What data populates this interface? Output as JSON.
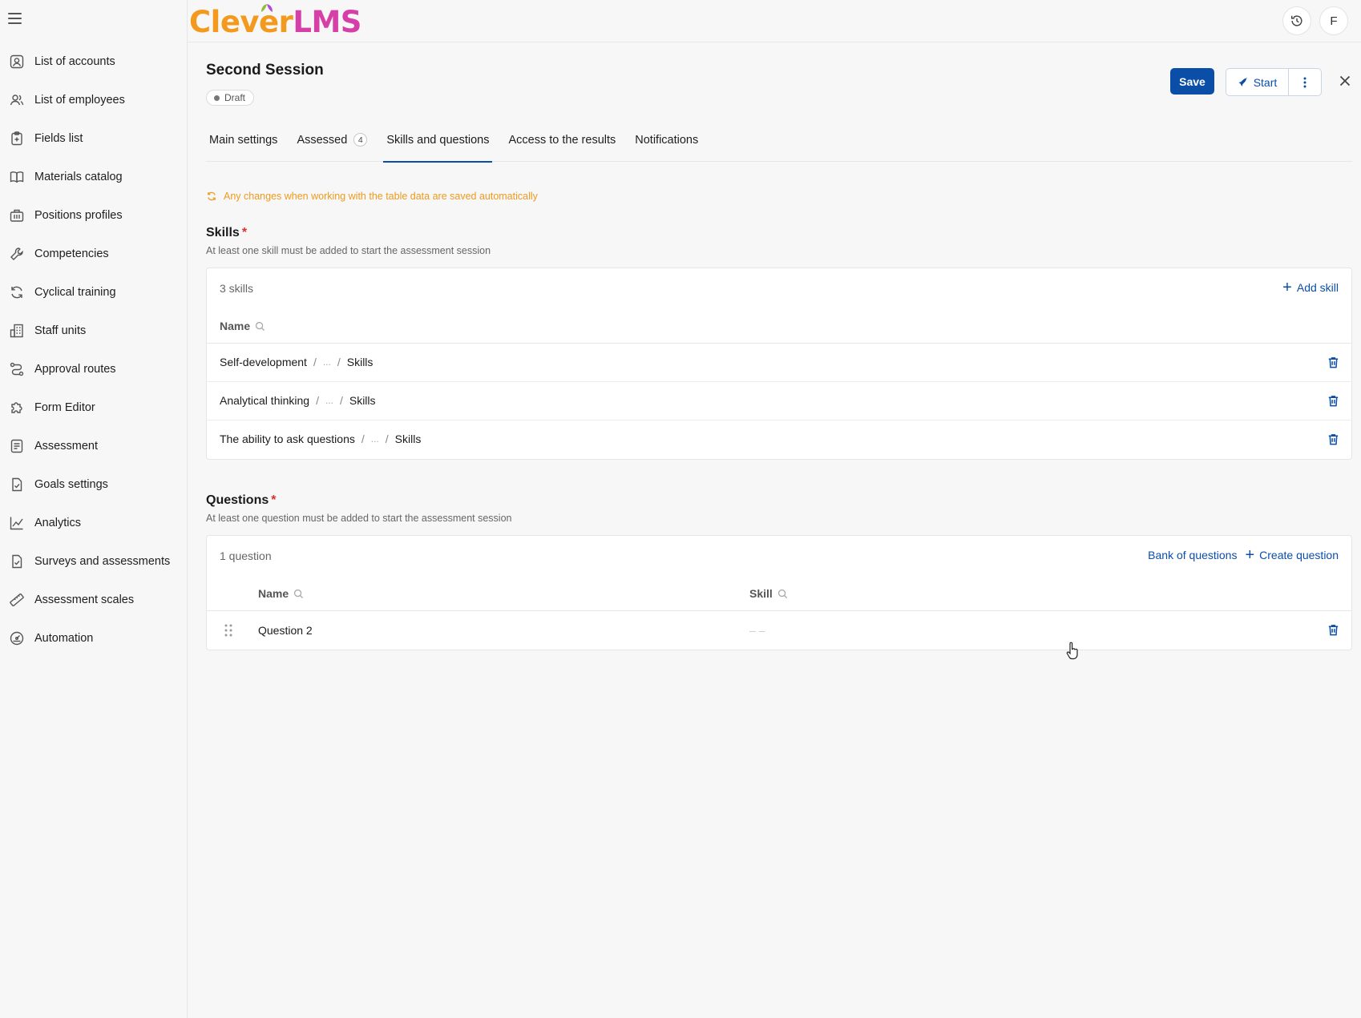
{
  "app": {
    "logo_part1": "Clever",
    "logo_part2": "LMS",
    "user_initial": "F"
  },
  "sidebar": {
    "items": [
      {
        "label": "List of accounts",
        "icon": "account-icon"
      },
      {
        "label": "List of employees",
        "icon": "employees-icon"
      },
      {
        "label": "Fields list",
        "icon": "fields-icon"
      },
      {
        "label": "Materials catalog",
        "icon": "book-icon"
      },
      {
        "label": "Positions profiles",
        "icon": "building-icon"
      },
      {
        "label": "Competencies",
        "icon": "wrench-icon"
      },
      {
        "label": "Cyclical training",
        "icon": "cycle-icon"
      },
      {
        "label": "Staff units",
        "icon": "staff-icon"
      },
      {
        "label": "Approval routes",
        "icon": "route-icon"
      },
      {
        "label": "Form Editor",
        "icon": "puzzle-icon"
      },
      {
        "label": "Assessment",
        "icon": "assessment-icon"
      },
      {
        "label": "Goals settings",
        "icon": "goals-icon"
      },
      {
        "label": "Analytics",
        "icon": "analytics-icon"
      },
      {
        "label": "Surveys and assessments",
        "icon": "survey-icon"
      },
      {
        "label": "Assessment scales",
        "icon": "ruler-icon"
      },
      {
        "label": "Automation",
        "icon": "automation-icon"
      }
    ]
  },
  "page": {
    "title": "Second Session",
    "status": "Draft",
    "save_label": "Save",
    "start_label": "Start"
  },
  "tabs": [
    {
      "label": "Main settings",
      "active": false
    },
    {
      "label": "Assessed",
      "count": "4",
      "active": false
    },
    {
      "label": "Skills and questions",
      "active": true
    },
    {
      "label": "Access to the results",
      "active": false
    },
    {
      "label": "Notifications",
      "active": false
    }
  ],
  "notice": "Any changes when working with the table data are saved automatically",
  "skills": {
    "title": "Skills",
    "required_mark": "*",
    "subtitle": "At least one skill must be added to start the assessment session",
    "count": "3 skills",
    "add_label": "Add skill",
    "column_name": "Name",
    "rows": [
      {
        "name": "Self-development",
        "middle": "...",
        "parent": "Skills"
      },
      {
        "name": "Analytical thinking",
        "middle": "...",
        "parent": "Skills"
      },
      {
        "name": "The ability to ask questions",
        "middle": "...",
        "parent": "Skills"
      }
    ]
  },
  "questions": {
    "title": "Questions",
    "required_mark": "*",
    "subtitle": "At least one question must be added to start the assessment session",
    "count": "1 question",
    "bank_label": "Bank of questions",
    "create_label": "Create question",
    "column_name": "Name",
    "column_skill": "Skill",
    "rows": [
      {
        "name": "Question 2",
        "skill": "– –"
      }
    ]
  },
  "colors": {
    "primary": "#0a4ea8",
    "warning": "#ef9a1c",
    "required": "#d9302f",
    "logo_orange": "#f39a1e",
    "logo_pink": "#d63fa8"
  }
}
